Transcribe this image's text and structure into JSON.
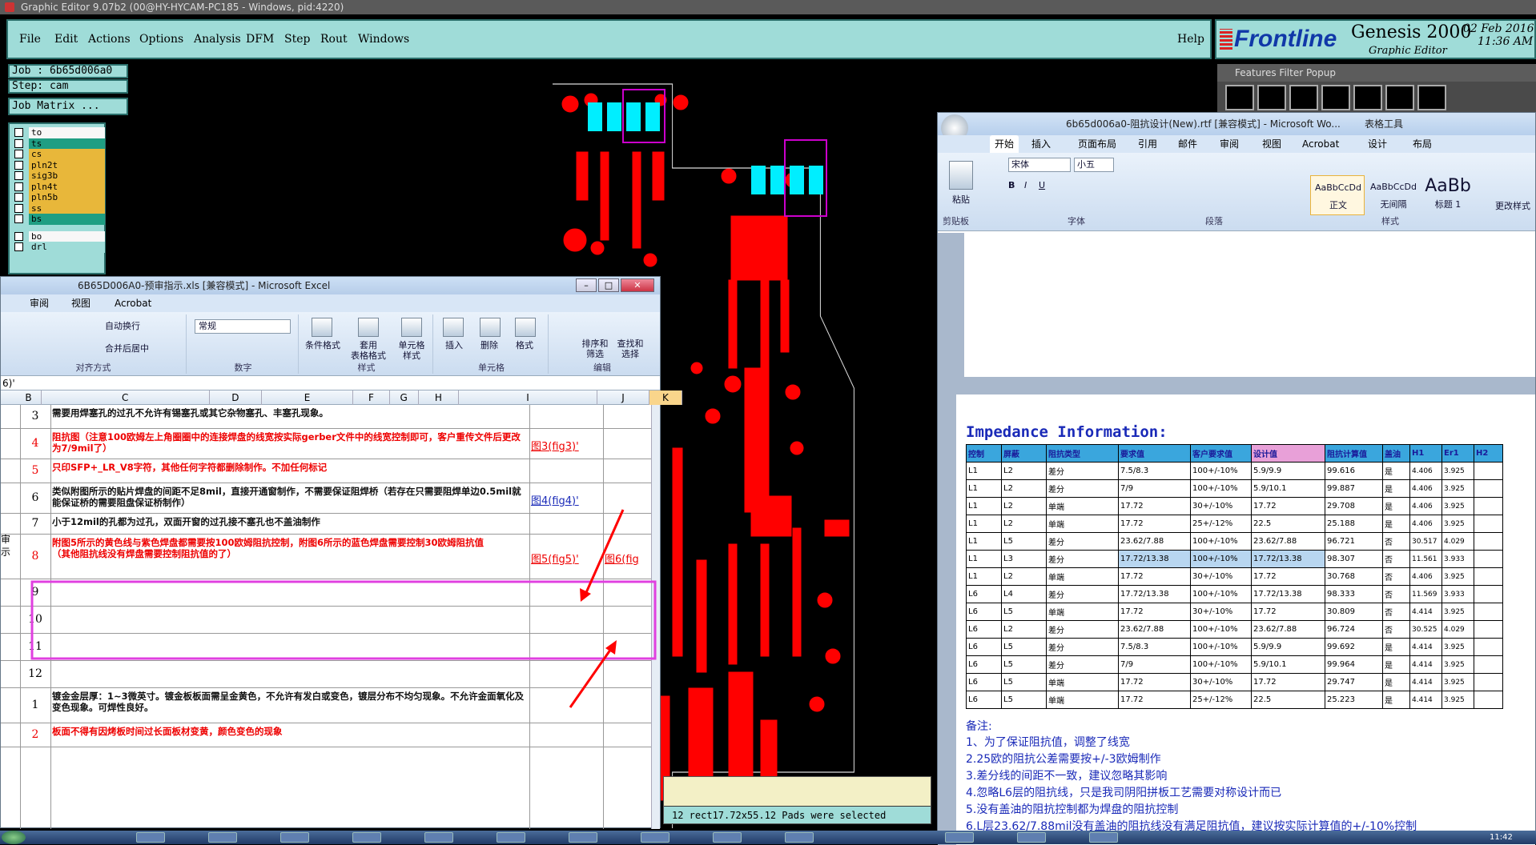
{
  "genesis": {
    "title": "Graphic Editor 9.07b2 (00@HY-HYCAM-PC185 - Windows, pid:4220)",
    "menu": [
      "File",
      "Edit",
      "Actions",
      "Options",
      "Analysis",
      "DFM",
      "Step",
      "Rout",
      "Windows"
    ],
    "help": "Help",
    "brand": {
      "logo": "Frontline",
      "name": "Genesis 2000",
      "sub": "Graphic Editor",
      "date": "02 Feb 2016",
      "time": "11:36 AM"
    },
    "job": "Job : 6b65d006a0",
    "step": "Step: cam",
    "job_matrix": "Job Matrix ...",
    "layers": [
      {
        "name": "to",
        "color": "#f7f7f7"
      },
      {
        "name": "ts",
        "color": "#1f9e83"
      },
      {
        "name": "cs",
        "color": "#e8b73a"
      },
      {
        "name": "pln2t",
        "color": "#e8b73a"
      },
      {
        "name": "sig3b",
        "color": "#e8b73a"
      },
      {
        "name": "pln4t",
        "color": "#e8b73a"
      },
      {
        "name": "pln5b",
        "color": "#e8b73a"
      },
      {
        "name": "ss",
        "color": "#e8b73a"
      },
      {
        "name": "bs",
        "color": "#1f9e83"
      },
      {
        "name": "bo",
        "color": "#f7f7f7"
      },
      {
        "name": "drl",
        "color": "#9fdcd8"
      }
    ],
    "status": "12 rect17.72x55.12 Pads were selected",
    "popup_title": "Features Filter Popup"
  },
  "excel": {
    "title": "6B65D006A0-预审指示.xls [兼容模式] - Microsoft Excel",
    "tabs": [
      "审阅",
      "视图",
      "Acrobat"
    ],
    "ribbon": {
      "wrap": "自动换行",
      "merge": "合并后居中",
      "align_group": "对齐方式",
      "number_format": "常规",
      "number_group": "数字",
      "cond": "条件格式",
      "table_fmt": "套用\n表格格式",
      "cell_style": "单元格\n样式",
      "style_group": "样式",
      "insert": "插入",
      "delete": "删除",
      "format": "格式",
      "cells_group": "单元格",
      "sort": "排序和\n筛选",
      "find": "查找和\n选择",
      "edit_group": "编辑"
    },
    "formula": "6)'",
    "columns": [
      "B",
      "C",
      "D",
      "E",
      "F",
      "G",
      "H",
      "I",
      "J",
      "K"
    ],
    "side_text": "审\n示",
    "rows": [
      {
        "num": "3",
        "text": "需要用焊塞孔的过孔不允许有锡塞孔或其它杂物塞孔、丰塞孔现象。",
        "link": "",
        "red": false
      },
      {
        "num": "4",
        "text": "阻抗图（注意100欧姆左上角圈圈中的连接焊盘的线宽按实际gerber文件中的线宽控制即可，客户重传文件后更改为7/9mil了）",
        "link": "图3(fig3)'",
        "red": true
      },
      {
        "num": "5",
        "text": "只印SFP+_LR_V8字符，其他任何字符都删除制作。不加任何标记",
        "link": "",
        "red": true
      },
      {
        "num": "6",
        "text": "类似附图所示的贴片焊盘的间距不足8mil，直接开通窗制作，不需要保证阻焊桥（若存在只需要阻焊单边0.5mil就能保证桥的需要阻盘保证桥制作）",
        "link": "图4(fig4)'",
        "red": false
      },
      {
        "num": "7",
        "text": "小于12mil的孔都为过孔，双面开窗的过孔接不塞孔也不盖油制作",
        "link": "",
        "red": false
      },
      {
        "num": "8",
        "text": "附图5所示的黄色线与紫色焊盘都需要按100欧姆阻抗控制，附图6所示的蓝色焊盘需要控制30欧姆阻抗值\n（其他阻抗线没有焊盘需要控制阻抗值的了）",
        "link": "图5(fig5)'",
        "link2": "图6(fig",
        "red": true
      },
      {
        "num": "9",
        "text": "",
        "link": "",
        "red": false
      },
      {
        "num": "10",
        "text": "",
        "link": "",
        "red": false
      },
      {
        "num": "11",
        "text": "",
        "link": "",
        "red": false
      },
      {
        "num": "12",
        "text": "",
        "link": "",
        "red": false
      },
      {
        "num": "1",
        "text": "镀金金层厚：1~3微英寸。镀金板板面需呈金黄色，不允许有发白或变色，镀层分布不均匀现象。不允许金面氧化及变色现象。可焊性良好。",
        "link": "",
        "red": false
      },
      {
        "num": "2",
        "text": "板面不得有因烤板时间过长面板材变黄，颜色变色的现象",
        "link": "",
        "red": true
      }
    ]
  },
  "word": {
    "title": "6b65d006a0-阻抗设计(New).rtf [兼容模式] - Microsoft Wo...",
    "table_tools": "表格工具",
    "tabs": [
      "开始",
      "插入",
      "页面布局",
      "引用",
      "邮件",
      "审阅",
      "视图",
      "Acrobat",
      "设计",
      "布局"
    ],
    "ribbon": {
      "paste": "粘贴",
      "clipboard": "剪贴板",
      "font_name": "宋体",
      "font_size": "小五",
      "font_group": "字体",
      "para_group": "段落",
      "styles": [
        "AaBbCcDd",
        "AaBbCcDd",
        "AaBb"
      ],
      "style_names": [
        "正文",
        "无间隔",
        "标题 1"
      ],
      "style_group": "样式",
      "change_style": "更改样式"
    },
    "heading": "Impedance Information:",
    "table_header": [
      "控制",
      "屏蔽",
      "阻抗类型",
      "要求值",
      "客户要求值",
      "设计值",
      "阻抗计算值",
      "盖油",
      "H1",
      "Er1",
      "H2"
    ],
    "table_rows": [
      [
        "L1",
        "L2",
        "差分",
        "7.5/8.3",
        "100+/-10%",
        "5.9/9.9",
        "99.616",
        "是",
        "4.406",
        "3.925",
        ""
      ],
      [
        "L1",
        "L2",
        "差分",
        "7/9",
        "100+/-10%",
        "5.9/10.1",
        "99.887",
        "是",
        "4.406",
        "3.925",
        ""
      ],
      [
        "L1",
        "L2",
        "单端",
        "17.72",
        "30+/-10%",
        "17.72",
        "29.708",
        "是",
        "4.406",
        "3.925",
        ""
      ],
      [
        "L1",
        "L2",
        "单端",
        "17.72",
        "25+/-12%",
        "22.5",
        "25.188",
        "是",
        "4.406",
        "3.925",
        ""
      ],
      [
        "L1",
        "L5",
        "差分",
        "23.62/7.88",
        "100+/-10%",
        "23.62/7.88",
        "96.721",
        "否",
        "30.517",
        "4.029",
        ""
      ],
      [
        "L1",
        "L3",
        "差分",
        "17.72/13.38",
        "100+/-10%",
        "17.72/13.38",
        "98.307",
        "否",
        "11.561",
        "3.933",
        ""
      ],
      [
        "L1",
        "L2",
        "单端",
        "17.72",
        "30+/-10%",
        "17.72",
        "30.768",
        "否",
        "4.406",
        "3.925",
        ""
      ],
      [
        "L6",
        "L4",
        "差分",
        "17.72/13.38",
        "100+/-10%",
        "17.72/13.38",
        "98.333",
        "否",
        "11.569",
        "3.933",
        ""
      ],
      [
        "L6",
        "L5",
        "单端",
        "17.72",
        "30+/-10%",
        "17.72",
        "30.809",
        "否",
        "4.414",
        "3.925",
        ""
      ],
      [
        "L6",
        "L2",
        "差分",
        "23.62/7.88",
        "100+/-10%",
        "23.62/7.88",
        "96.724",
        "否",
        "30.525",
        "4.029",
        ""
      ],
      [
        "L6",
        "L5",
        "差分",
        "7.5/8.3",
        "100+/-10%",
        "5.9/9.9",
        "99.692",
        "是",
        "4.414",
        "3.925",
        ""
      ],
      [
        "L6",
        "L5",
        "差分",
        "7/9",
        "100+/-10%",
        "5.9/10.1",
        "99.964",
        "是",
        "4.414",
        "3.925",
        ""
      ],
      [
        "L6",
        "L5",
        "单端",
        "17.72",
        "30+/-10%",
        "17.72",
        "29.747",
        "是",
        "4.414",
        "3.925",
        ""
      ],
      [
        "L6",
        "L5",
        "单端",
        "17.72",
        "25+/-12%",
        "22.5",
        "25.223",
        "是",
        "4.414",
        "3.925",
        ""
      ]
    ],
    "notes_title": "备注:",
    "notes": [
      "1、为了保证阻抗值，调整了线宽",
      "2.25欧的阻抗公差需要按+/-3欧姆制作",
      "3.差分线的间距不一致，建议忽略其影响",
      "4.忽略L6层的阻抗线，只是我司阴阳拼板工艺需要对称设计而已",
      "5.没有盖油的阻抗控制都为焊盘的阻抗控制",
      "6.L层23.62/7.88mil没有盖油的阻抗线没有满足阻抗值，建议按实际计算值的+/-10%控制"
    ]
  },
  "taskbar": {
    "clock": "11:42"
  }
}
